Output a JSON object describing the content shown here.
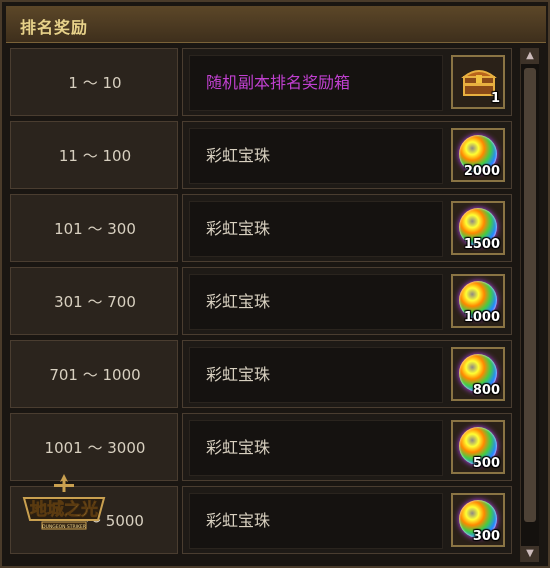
{
  "panel": {
    "title": "排名奖励"
  },
  "rows": [
    {
      "rank": "1 ～ 10",
      "reward": "随机副本排名奖励箱",
      "reward_color": "#c040d0",
      "icon": "treasure-chest-icon",
      "qty": "1"
    },
    {
      "rank": "11 ～ 100",
      "reward": "彩虹宝珠",
      "reward_color": "#d8d0c0",
      "icon": "rainbow-orb-icon",
      "qty": "2000"
    },
    {
      "rank": "101 ～ 300",
      "reward": "彩虹宝珠",
      "reward_color": "#d8d0c0",
      "icon": "rainbow-orb-icon",
      "qty": "1500"
    },
    {
      "rank": "301 ～ 700",
      "reward": "彩虹宝珠",
      "reward_color": "#d8d0c0",
      "icon": "rainbow-orb-icon",
      "qty": "1000"
    },
    {
      "rank": "701 ～ 1000",
      "reward": "彩虹宝珠",
      "reward_color": "#d8d0c0",
      "icon": "rainbow-orb-icon",
      "qty": "800"
    },
    {
      "rank": "1001 ～ 3000",
      "reward": "彩虹宝珠",
      "reward_color": "#d8d0c0",
      "icon": "rainbow-orb-icon",
      "qty": "500"
    },
    {
      "rank": "～ 5000",
      "reward": "彩虹宝珠",
      "reward_color": "#d8d0c0",
      "icon": "rainbow-orb-icon",
      "qty": "300"
    }
  ],
  "logo": {
    "text": "地城之光",
    "subtitle": "DUNGEON STRIKER"
  }
}
